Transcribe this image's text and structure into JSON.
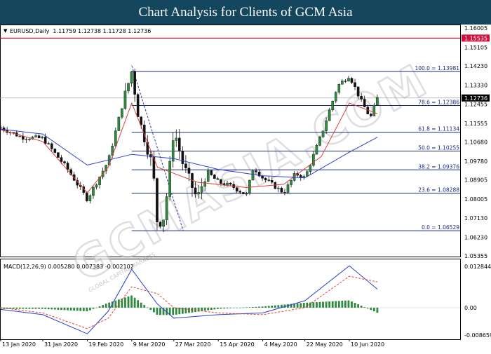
{
  "banner": {
    "title": "Chart Analysis for Clients of GCM Asia"
  },
  "chart_header": {
    "marker": "▼",
    "symbol_info": "EURUSD,Daily  1.11759 1.12738 1.11728 1.12736"
  },
  "price_axis": {
    "ticks": [
      "1.16005",
      "1.15105",
      "1.14230",
      "1.13330",
      "1.12455",
      "1.11555",
      "1.10680",
      "1.09780",
      "1.08905",
      "1.08005",
      "1.07130",
      "1.06230",
      "1.05355"
    ],
    "resistance_label": "1.15535",
    "current_price_label": "1.12736"
  },
  "fibonacci": [
    {
      "label": "100.0 = 1.13981",
      "value": 1.13981
    },
    {
      "label": "78.6 = 1.12386",
      "value": 1.12386
    },
    {
      "label": "61.8 = 1.11134",
      "value": 1.11134
    },
    {
      "label": "50.0 = 1.10255",
      "value": 1.10255
    },
    {
      "label": "38.2 = 1.09376",
      "value": 1.09376
    },
    {
      "label": "23.6 = 1.08288",
      "value": 1.08288
    },
    {
      "label": "0.0 = 1.06529",
      "value": 1.06529
    }
  ],
  "macd": {
    "header": "MACD(12,26,9) 0.005280 0.007383 -0.002102",
    "ticks": [
      "0.012844",
      "0.00",
      "-0.008659"
    ]
  },
  "date_axis": [
    "13 Jan 2020",
    "31 Jan 2020",
    "19 Feb 2020",
    "9 Mar 2020",
    "27 Mar 2020",
    "15 Apr 2020",
    "4 May 2020",
    "22 May 2020",
    "10 Jun 2020"
  ],
  "watermark": {
    "text": "GCMASIA.COM",
    "tagline": "GLOBAL CAPITAL MARKETS"
  },
  "chart_data": {
    "type": "candlestick",
    "symbol": "EURUSD",
    "timeframe": "Daily",
    "ohlc": {
      "open": 1.11759,
      "high": 1.12738,
      "low": 1.11728,
      "close": 1.12736
    },
    "ylim": [
      1.05355,
      1.16005
    ],
    "resistance": 1.15535,
    "close_path": [
      [
        "13 Jan 2020",
        1.1135
      ],
      [
        "22 Jan 2020",
        1.109
      ],
      [
        "31 Jan 2020",
        1.1085
      ],
      [
        "10 Feb 2020",
        1.095
      ],
      [
        "19 Feb 2020",
        1.08
      ],
      [
        "28 Feb 2020",
        1.098
      ],
      [
        "4 Mar 2020",
        1.12
      ],
      [
        "9 Mar 2020",
        1.14
      ],
      [
        "12 Mar 2020",
        1.118
      ],
      [
        "18 Mar 2020",
        1.095
      ],
      [
        "20 Mar 2020",
        1.068
      ],
      [
        "23 Mar 2020",
        1.072
      ],
      [
        "27 Mar 2020",
        1.113
      ],
      [
        "31 Mar 2020",
        1.096
      ],
      [
        "6 Apr 2020",
        1.08
      ],
      [
        "10 Apr 2020",
        1.093
      ],
      [
        "15 Apr 2020",
        1.088
      ],
      [
        "21 Apr 2020",
        1.086
      ],
      [
        "27 Apr 2020",
        1.082
      ],
      [
        "30 Apr 2020",
        1.095
      ],
      [
        "4 May 2020",
        1.09
      ],
      [
        "13 May 2020",
        1.083
      ],
      [
        "18 May 2020",
        1.092
      ],
      [
        "22 May 2020",
        1.09
      ],
      [
        "29 May 2020",
        1.11
      ],
      [
        "5 Jun 2020",
        1.133
      ],
      [
        "10 Jun 2020",
        1.138
      ],
      [
        "15 Jun 2020",
        1.126
      ],
      [
        "19 Jun 2020",
        1.118
      ],
      [
        "22 Jun 2020",
        1.1274
      ]
    ],
    "ma_fast": [
      [
        "13 Jan 2020",
        1.1125
      ],
      [
        "31 Jan 2020",
        1.107
      ],
      [
        "19 Feb 2020",
        1.083
      ],
      [
        "28 Feb 2020",
        1.095
      ],
      [
        "9 Mar 2020",
        1.125
      ],
      [
        "20 Mar 2020",
        1.095
      ],
      [
        "6 Apr 2020",
        1.088
      ],
      [
        "27 Apr 2020",
        1.0855
      ],
      [
        "13 May 2020",
        1.087
      ],
      [
        "29 May 2020",
        1.1
      ],
      [
        "10 Jun 2020",
        1.125
      ],
      [
        "22 Jun 2020",
        1.12
      ]
    ],
    "ma_slow": [
      [
        "13 Jan 2020",
        1.1128
      ],
      [
        "31 Jan 2020",
        1.1105
      ],
      [
        "19 Feb 2020",
        1.096
      ],
      [
        "9 Mar 2020",
        1.101
      ],
      [
        "27 Mar 2020",
        1.099
      ],
      [
        "15 Apr 2020",
        1.094
      ],
      [
        "4 May 2020",
        1.091
      ],
      [
        "22 May 2020",
        1.09
      ],
      [
        "10 Jun 2020",
        1.102
      ],
      [
        "22 Jun 2020",
        1.109
      ]
    ],
    "macd_line": [
      [
        "13 Jan 2020",
        -0.0005
      ],
      [
        "31 Jan 2020",
        -0.002
      ],
      [
        "19 Feb 2020",
        -0.0075
      ],
      [
        "28 Feb 2020",
        -0.001
      ],
      [
        "9 Mar 2020",
        0.011
      ],
      [
        "20 Mar 2020",
        0.001
      ],
      [
        "27 Mar 2020",
        -0.003
      ],
      [
        "15 Apr 2020",
        -0.002
      ],
      [
        "4 May 2020",
        -0.0015
      ],
      [
        "22 May 2020",
        0.002
      ],
      [
        "10 Jun 2020",
        0.012
      ],
      [
        "22 Jun 2020",
        0.0053
      ]
    ],
    "signal_line": [
      [
        "13 Jan 2020",
        0.0
      ],
      [
        "31 Jan 2020",
        -0.0015
      ],
      [
        "19 Feb 2020",
        -0.006
      ],
      [
        "28 Feb 2020",
        -0.003
      ],
      [
        "9 Mar 2020",
        0.006
      ],
      [
        "20 Mar 2020",
        0.004
      ],
      [
        "27 Mar 2020",
        0.0
      ],
      [
        "15 Apr 2020",
        -0.0015
      ],
      [
        "4 May 2020",
        -0.002
      ],
      [
        "22 May 2020",
        0.0
      ],
      [
        "10 Jun 2020",
        0.009
      ],
      [
        "22 Jun 2020",
        0.0074
      ]
    ],
    "macd_histogram_last": -0.002102,
    "colors": {
      "bull": "#2e8b3e",
      "bear": "#111111",
      "ma_fast": "#d6403a",
      "ma_slow": "#2a3fd1",
      "signal": "#e0403a",
      "fib": "#1b2a7a",
      "resistance": "#d0103a",
      "banner": "#14475e"
    }
  }
}
